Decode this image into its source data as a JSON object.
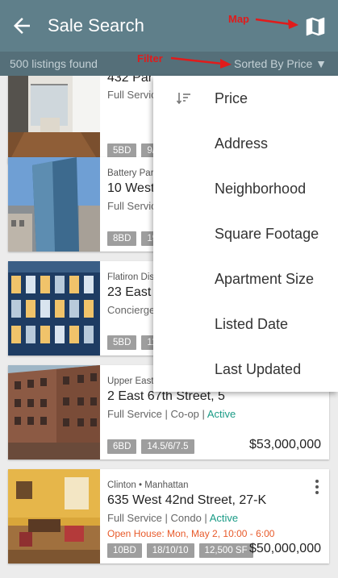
{
  "header": {
    "title": "Sale Search",
    "back_icon": "back-arrow-icon",
    "map_icon": "map-icon"
  },
  "subbar": {
    "count": "500 listings found",
    "sort_label": "Sorted By Price ▼"
  },
  "annotations": {
    "map": "Map",
    "filter": "Filter",
    "color": "#e01b1b"
  },
  "sort_menu": {
    "items": [
      {
        "label": "Price",
        "icon": "sort-icon"
      },
      {
        "label": "Address"
      },
      {
        "label": "Neighborhood"
      },
      {
        "label": "Square Footage"
      },
      {
        "label": "Apartment Size"
      },
      {
        "label": "Listed Date"
      },
      {
        "label": "Last Updated"
      }
    ]
  },
  "listings": [
    {
      "neighborhood": "",
      "address": "432 Par",
      "meta": "Full Service",
      "status": "",
      "open_house": "",
      "chips": [
        "5BD",
        "9/"
      ],
      "price": ""
    },
    {
      "neighborhood": "Battery Par",
      "address": "10 West",
      "meta": "Full Service",
      "status": "",
      "open_house": "",
      "chips": [
        "8BD",
        "19"
      ],
      "price": ""
    },
    {
      "neighborhood": "Flatiron Dis",
      "address": "23 East",
      "meta": "Concierge",
      "status": "",
      "open_house": "",
      "chips": [
        "5BD",
        "11"
      ],
      "price": ""
    },
    {
      "neighborhood": "Upper East",
      "address": "2 East 67th Street, 5",
      "meta": "Full Service | Co-op | ",
      "status": "Active",
      "open_house": "",
      "chips": [
        "6BD",
        "14.5/6/7.5"
      ],
      "price": "$53,000,000"
    },
    {
      "neighborhood": "Clinton • Manhattan",
      "address": "635 West 42nd Street, 27-K",
      "meta": "Full Service | Condo | ",
      "status": "Active",
      "open_house": "Open House: Mon, May 2, 10:00 - 6:00",
      "chips": [
        "10BD",
        "18/10/10",
        "12,500 SF"
      ],
      "price": "$50,000,000"
    }
  ],
  "colors": {
    "appbar": "#5f7f8a",
    "subbar": "#556f79",
    "active": "#1a9b86",
    "open_house": "#e85a2a",
    "chip": "#9e9e9e"
  }
}
